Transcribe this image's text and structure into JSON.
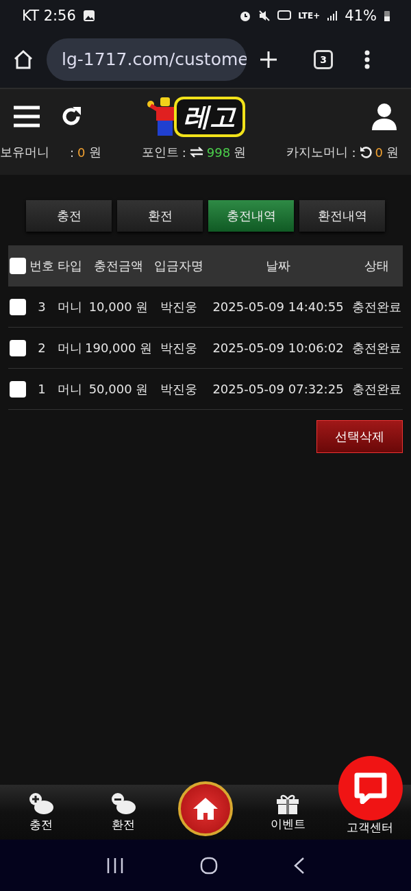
{
  "status_bar": {
    "carrier_time": "KT 2:56",
    "network": "LTE+",
    "battery": "41%"
  },
  "browser": {
    "url": "lg-1717.com/custome",
    "tab_count": "3"
  },
  "header": {
    "logo_text": "레고"
  },
  "balances": [
    {
      "label": "보유머니",
      "sep": ":",
      "value": "0",
      "unit": "원",
      "kind": "plain",
      "color": "#f0a030"
    },
    {
      "label": "포인트",
      "sep": ":",
      "value": "998",
      "unit": "원",
      "kind": "exchange",
      "color": "#4cd04c"
    },
    {
      "label": "카지노머니",
      "sep": ":",
      "value": "0",
      "unit": "원",
      "kind": "refresh",
      "color": "#f0a030"
    }
  ],
  "tabs": [
    {
      "label": "충전",
      "selected": false
    },
    {
      "label": "환전",
      "selected": false
    },
    {
      "label": "충전내역",
      "selected": true
    },
    {
      "label": "환전내역",
      "selected": false
    }
  ],
  "table": {
    "select_all_checked": false,
    "columns": [
      "번호",
      "타입",
      "충전금액",
      "입금자명",
      "날짜",
      "상태"
    ],
    "rows": [
      {
        "checked": false,
        "cells": [
          "3",
          "머니",
          "10,000 원",
          "박진웅",
          "2025-05-09 14:40:55",
          "충전완료"
        ]
      },
      {
        "checked": false,
        "cells": [
          "2",
          "머니",
          "190,000 원",
          "박진웅",
          "2025-05-09 10:06:02",
          "충전완료"
        ]
      },
      {
        "checked": false,
        "cells": [
          "1",
          "머니",
          "50,000 원",
          "박진웅",
          "2025-05-09 07:32:25",
          "충전완료"
        ]
      }
    ]
  },
  "delete_button": "선택삭제",
  "bottom_nav": [
    {
      "kind": "charge",
      "label": "충전"
    },
    {
      "kind": "exchange",
      "label": "환전"
    },
    {
      "kind": "home"
    },
    {
      "kind": "event",
      "label": "이벤트"
    },
    {
      "kind": "support",
      "label": "고객센터"
    }
  ]
}
